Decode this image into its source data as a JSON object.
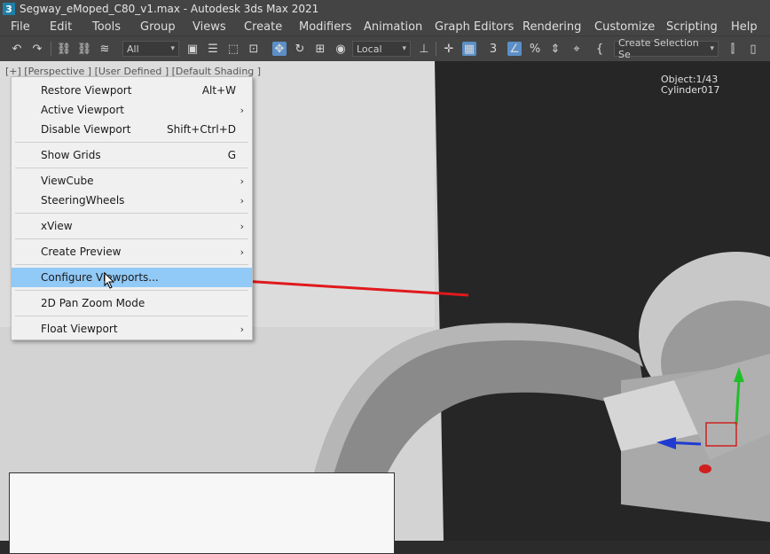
{
  "title": "Segway_eMoped_C80_v1.max - Autodesk 3ds Max 2021",
  "app_icon_text": "3",
  "menubar": [
    "File",
    "Edit",
    "Tools",
    "Group",
    "Views",
    "Create",
    "Modifiers",
    "Animation",
    "Graph Editors",
    "Rendering",
    "Customize",
    "Scripting",
    "Help"
  ],
  "toolbar": {
    "filter": "All",
    "ref_coord": "Local",
    "selection_set": "Create Selection Se"
  },
  "viewport": {
    "label": "[+] [Perspective ] [User Defined ] [Default Shading ]",
    "object_count": "Object:1/43",
    "object_name": "Cylinder017"
  },
  "context_menu": {
    "items": [
      {
        "label": "Restore Viewport",
        "shortcut": "Alt+W"
      },
      {
        "label": "Active Viewport",
        "submenu": true
      },
      {
        "label": "Disable Viewport",
        "shortcut": "Shift+Ctrl+D"
      },
      {
        "label": "Show Grids",
        "shortcut": "G"
      },
      {
        "label": "ViewCube",
        "submenu": true
      },
      {
        "label": "SteeringWheels",
        "submenu": true
      },
      {
        "label": "xView",
        "submenu": true
      },
      {
        "label": "Create Preview",
        "submenu": true
      },
      {
        "label": "Configure Viewports...",
        "highlighted": true
      },
      {
        "label": "2D Pan Zoom Mode"
      },
      {
        "label": "Float Viewport",
        "submenu": true
      }
    ],
    "submenu_glyph": "›"
  },
  "colors": {
    "highlight": "#91c9f7",
    "annotation_arrow": "#e0191c",
    "gizmo_y": "#1fbf2a",
    "gizmo_z": "#1f3bd0"
  }
}
